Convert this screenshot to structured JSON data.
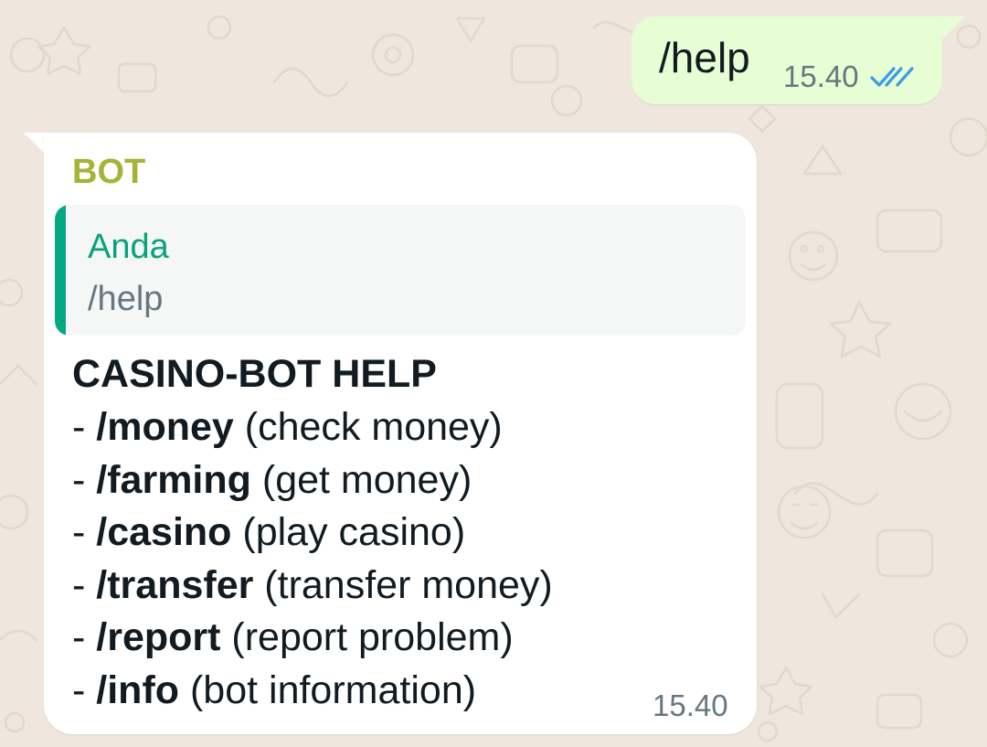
{
  "outgoing_message": {
    "text": "/help",
    "time": "15.40",
    "status_icon": "double-check-read-icon",
    "status_color": "#3b9be8"
  },
  "incoming_message": {
    "sender": "BOT",
    "sender_color": "#a5b337",
    "quote": {
      "author": "Anda",
      "text": "/help",
      "accent_color": "#06a884"
    },
    "title": "CASINO-BOT HELP",
    "commands": [
      {
        "prefix": "- ",
        "command": "/money",
        "description": " (check money)"
      },
      {
        "prefix": "- ",
        "command": "/farming",
        "description": " (get money)"
      },
      {
        "prefix": "- ",
        "command": "/casino",
        "description": " (play casino)"
      },
      {
        "prefix": "- ",
        "command": "/transfer",
        "description": " (transfer money)"
      },
      {
        "prefix": "- ",
        "command": "/report",
        "description": " (report problem)"
      },
      {
        "prefix": "- ",
        "command": "/info",
        "description": " (bot information)"
      }
    ],
    "time": "15.40"
  },
  "colors": {
    "chat_background": "#efe7dd",
    "outgoing_bubble": "#e7fdd3",
    "incoming_bubble": "#ffffff",
    "quote_background": "#f5f6f6"
  }
}
